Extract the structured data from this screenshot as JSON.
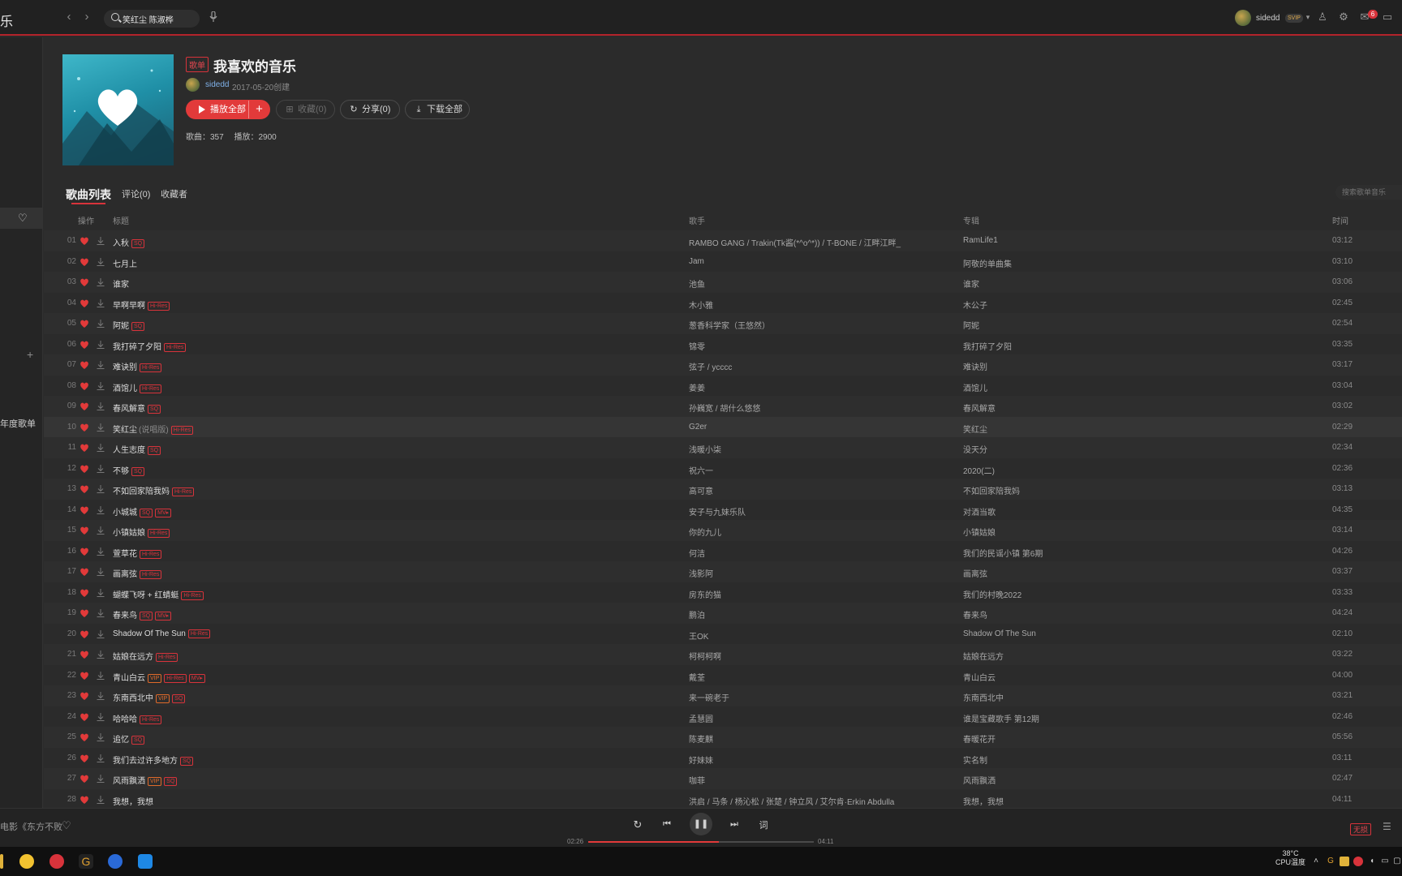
{
  "app": {
    "title": "乐"
  },
  "search": {
    "value": "笑红尘 陈淑桦"
  },
  "user": {
    "name": "sidedd",
    "vip": "SVIP",
    "messages": "6"
  },
  "sidebar": {
    "year_playlist": "年度歌单"
  },
  "playlist": {
    "tag": "歌单",
    "title": "我喜欢的音乐",
    "creator": "sidedd",
    "created": "2017-05-20创建",
    "play_all": "播放全部",
    "collect": "收藏(0)",
    "share": "分享(0)",
    "download_all": "下载全部",
    "songs_label": "歌曲：357",
    "plays_label": "播放：2900"
  },
  "tabs": {
    "songs": "歌曲列表",
    "comments": "评论(0)",
    "collectors": "收藏者"
  },
  "playlist_search": {
    "placeholder": "搜索歌单音乐"
  },
  "columns": {
    "ops": "操作",
    "title": "标题",
    "artist": "歌手",
    "album": "专辑",
    "time": "时间"
  },
  "songs": [
    {
      "no": "01",
      "title": "入秋",
      "badges": [
        "SQ"
      ],
      "artist": "RAMBO GANG / Trakin(Tk酱(*^o^*)) / T-BONE / 江畔江畔_",
      "album": "RamLife1",
      "time": "03:12"
    },
    {
      "no": "02",
      "title": "七月上",
      "badges": [],
      "artist": "Jam",
      "album": "阿敬的单曲集",
      "time": "03:10"
    },
    {
      "no": "03",
      "title": "谁家",
      "badges": [],
      "artist": "池鱼",
      "album": "谁家",
      "time": "03:06"
    },
    {
      "no": "04",
      "title": "早啊早啊",
      "badges": [
        "Hi-Res"
      ],
      "artist": "木小雅",
      "album": "木公子",
      "time": "02:45"
    },
    {
      "no": "05",
      "title": "阿妮",
      "badges": [
        "SQ"
      ],
      "artist": "葱香科学家（王悠然）",
      "album": "阿妮",
      "time": "02:54"
    },
    {
      "no": "06",
      "title": "我打碎了夕阳",
      "badges": [
        "Hi-Res"
      ],
      "artist": "锦零",
      "album": "我打碎了夕阳",
      "time": "03:35"
    },
    {
      "no": "07",
      "title": "难诀别",
      "badges": [
        "Hi-Res"
      ],
      "artist": "弦子 / ycccc",
      "album": "难诀别",
      "time": "03:17"
    },
    {
      "no": "08",
      "title": "酒馆儿",
      "badges": [
        "Hi-Res"
      ],
      "artist": "姜姜",
      "album": "酒馆儿",
      "time": "03:04"
    },
    {
      "no": "09",
      "title": "春风解意",
      "badges": [
        "SQ"
      ],
      "artist": "孙巍宽 / 胡什么悠悠",
      "album": "春风解意",
      "time": "03:02"
    },
    {
      "no": "10",
      "title": "笑红尘",
      "subtitle": "(说唱版)",
      "badges": [
        "Hi-Res"
      ],
      "artist": "G2er",
      "album": "笑红尘",
      "time": "02:29"
    },
    {
      "no": "11",
      "title": "人生志度",
      "badges": [
        "SQ"
      ],
      "artist": "浅暖小柒",
      "album": "没天分",
      "time": "02:34"
    },
    {
      "no": "12",
      "title": "不够",
      "badges": [
        "SQ"
      ],
      "artist": "祝六一",
      "album": "2020(二)",
      "time": "02:36"
    },
    {
      "no": "13",
      "title": "不如回家陪我妈",
      "badges": [
        "Hi-Res"
      ],
      "artist": "高可意",
      "album": "不如回家陪我妈",
      "time": "03:13"
    },
    {
      "no": "14",
      "title": "小城城",
      "badges": [
        "SQ",
        "MV▸"
      ],
      "artist": "安子与九妹乐队",
      "album": "对酒当歌",
      "time": "04:35"
    },
    {
      "no": "15",
      "title": "小镇姑娘",
      "badges": [
        "Hi-Res"
      ],
      "artist": "你的九儿",
      "album": "小镇姑娘",
      "time": "03:14"
    },
    {
      "no": "16",
      "title": "萱草花",
      "badges": [
        "Hi-Res"
      ],
      "artist": "何洁",
      "album": "我们的民谣小镇 第6期",
      "time": "04:26"
    },
    {
      "no": "17",
      "title": "画离弦",
      "badges": [
        "Hi-Res"
      ],
      "artist": "浅影阿",
      "album": "画离弦",
      "time": "03:37"
    },
    {
      "no": "18",
      "title": "蝴蝶飞呀 + 红蜻蜓",
      "badges": [
        "Hi-Res"
      ],
      "artist": "房东的猫",
      "album": "我们的村晚2022",
      "time": "03:33"
    },
    {
      "no": "19",
      "title": "春来鸟",
      "badges": [
        "SQ",
        "MV▸"
      ],
      "artist": "鹏泊",
      "album": "春来鸟",
      "time": "04:24"
    },
    {
      "no": "20",
      "title": "Shadow Of The Sun",
      "badges": [
        "Hi-Res"
      ],
      "artist": "王OK",
      "album": "Shadow Of The Sun",
      "time": "02:10"
    },
    {
      "no": "21",
      "title": "姑娘在远方",
      "badges": [
        "Hi-Res"
      ],
      "artist": "柯柯柯啊",
      "album": "姑娘在远方",
      "time": "03:22"
    },
    {
      "no": "22",
      "title": "青山白云",
      "badges": [
        "VIP",
        "Hi-Res",
        "MV▸"
      ],
      "artist": "戴荃",
      "album": "青山白云",
      "time": "04:00"
    },
    {
      "no": "23",
      "title": "东南西北中",
      "badges": [
        "VIP",
        "SQ"
      ],
      "artist": "来一碗老于",
      "album": "东南西北中",
      "time": "03:21"
    },
    {
      "no": "24",
      "title": "哈哈哈",
      "badges": [
        "Hi-Res"
      ],
      "artist": "孟慧圆",
      "album": "谁是宝藏歌手 第12期",
      "time": "02:46"
    },
    {
      "no": "25",
      "title": "追忆",
      "badges": [
        "SQ"
      ],
      "artist": "陈麦麒",
      "album": "春暖花开",
      "time": "05:56"
    },
    {
      "no": "26",
      "title": "我们去过许多地方",
      "badges": [
        "SQ"
      ],
      "artist": "好妹妹",
      "album": "实名制",
      "time": "03:11"
    },
    {
      "no": "27",
      "title": "风雨飘洒",
      "badges": [
        "VIP",
        "SQ"
      ],
      "artist": "咖菲",
      "album": "风雨飘洒",
      "time": "02:47"
    },
    {
      "no": "28",
      "title": "我想，我想",
      "badges": [],
      "artist": "洪启 / 马条 / 杨沁松 / 张楚 / 钟立风 / 艾尔肯·Erkin Abdulla",
      "album": "我想，我想",
      "time": "04:11"
    }
  ],
  "player": {
    "now_playing": "电影《东方不败",
    "current_time": "02:26",
    "total_time": "04:11",
    "progress_fraction": 0.58,
    "quality": "无损"
  },
  "taskbar": {
    "temp": "38°C",
    "temp_label": "CPU温度"
  },
  "colors": {
    "accent": "#e23a3a",
    "background": "#2b2b2b",
    "topbar": "#212121"
  }
}
